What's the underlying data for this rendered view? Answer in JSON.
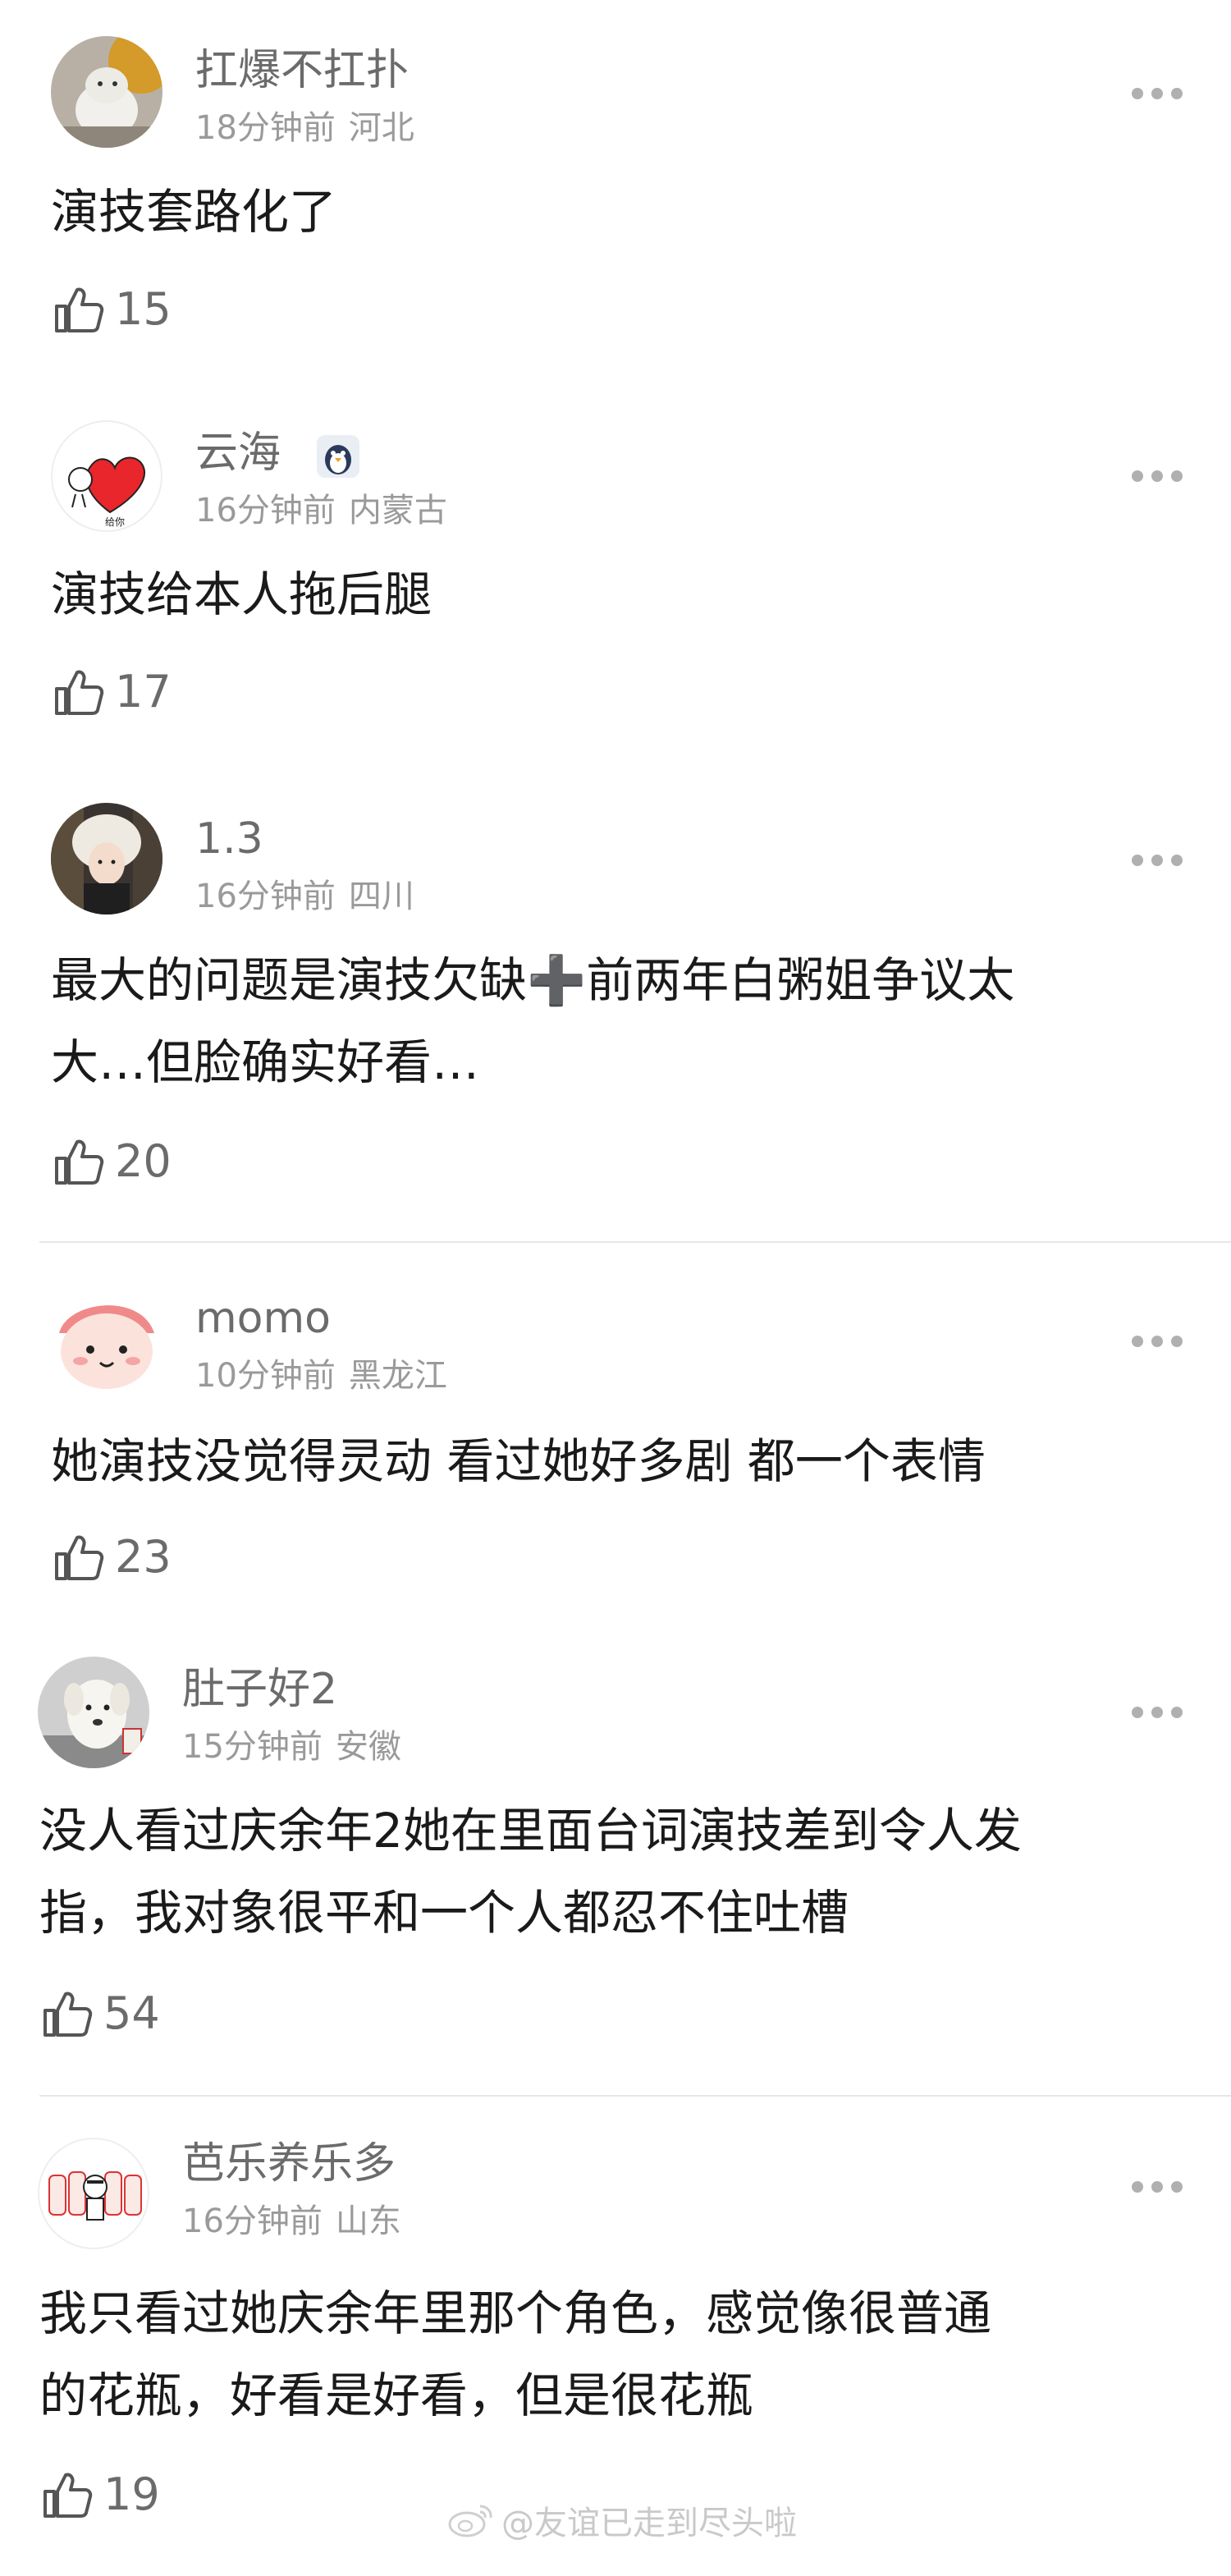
{
  "comments": [
    {
      "username": "扛爆不扛扑",
      "time": "18分钟前",
      "location": "河北",
      "lines": [
        "演技套路化了"
      ],
      "likes": "15",
      "avatar_icon": "cat-photo-avatar"
    },
    {
      "username": "云海",
      "time": "16分钟前",
      "location": "内蒙古",
      "lines": [
        "演技给本人拖后腿"
      ],
      "likes": "17",
      "avatar_icon": "heart-doodle-avatar",
      "badge_icon": "penguin-badge-icon"
    },
    {
      "username": "1.3",
      "time": "16分钟前",
      "location": "四川",
      "lines": [
        "最大的问题是演技欠缺➕前两年白粥姐争议太",
        "大…但脸确实好看…"
      ],
      "likes": "20",
      "avatar_icon": "girl-fur-hat-avatar"
    },
    {
      "username": "momo",
      "time": "10分钟前",
      "location": "黑龙江",
      "lines": [
        "她演技没觉得灵动 看过她好多剧 都一个表情"
      ],
      "likes": "23",
      "avatar_icon": "peach-character-avatar"
    },
    {
      "username": "肚子好2",
      "time": "15分钟前",
      "location": "安徽",
      "lines": [
        "没人看过庆余年2她在里面台词演技差到令人发",
        "指，我对象很平和一个人都忍不住吐槽"
      ],
      "likes": "54",
      "avatar_icon": "white-dog-avatar"
    },
    {
      "username": "芭乐养乐多",
      "time": "16分钟前",
      "location": "山东",
      "lines": [
        "我只看过她庆余年里那个角色，感觉像很普通",
        "的花瓶，好看是好看，但是很花瓶"
      ],
      "likes": "19",
      "avatar_icon": "yakult-bottles-avatar"
    }
  ],
  "watermark": {
    "text": "@友谊已走到尽头啦",
    "icon": "weibo-logo-icon"
  },
  "colors": {
    "username": "#6b6b6b",
    "meta": "#9a9a9a",
    "body": "#1a1a1a",
    "divider": "#e6e6e6"
  }
}
